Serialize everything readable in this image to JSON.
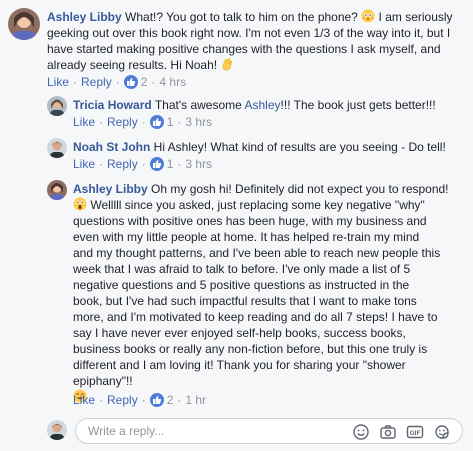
{
  "comments": [
    {
      "author": "Ashley Libby",
      "text_lines": [
        " What!? You got to talk to him on the phone? ",
        " I am seriously",
        "geeking out over this book right now. I'm not even 1/3 of the way into it, but I",
        "have started making positive changes with the questions I ask myself, and",
        "already seeing results. Hi Noah! "
      ],
      "like_label": "Like",
      "reply_label": "Reply",
      "reaction_count": "2",
      "time": "4 hrs"
    },
    {
      "author": "Tricia Howard",
      "text_before": " That's awesome ",
      "mention": "Ashley",
      "text_after": "!!! The book just gets better!!!",
      "like_label": "Like",
      "reply_label": "Reply",
      "reaction_count": "1",
      "time": "3 hrs"
    },
    {
      "author": "Noah St John",
      "text": " Hi Ashley! What kind of results are you seeing - Do tell!",
      "like_label": "Like",
      "reply_label": "Reply",
      "reaction_count": "1",
      "time": "3 hrs"
    },
    {
      "author": "Ashley Libby",
      "first_line": " Oh my gosh hi! Definitely did not expect you to respond!",
      "text_lines": [
        " Welllll since you asked, just replacing some key negative \"why\"",
        "questions with positive ones has been huge, with my business and",
        "even with my little people at home. It has helped re-train my mind",
        "and my thought patterns, and I've been able to reach new people this",
        "week that I was afraid to talk to before. I've only made a list of 5",
        "negative questions and 5 positive questions as instructed in the",
        "book, but I've had such impactful results that I want to make tons",
        "more, and I'm motivated to keep reading and do all 7 steps! I have to",
        "say I have never ever enjoyed self-help books, success books,",
        "business books or really any non-fiction before, but this one truly is",
        "different and I am loving it! Thank you for sharing your \"shower",
        "epiphany\"!! "
      ],
      "like_label": "Like",
      "reply_label": "Reply",
      "reaction_count": "2",
      "time": "1 hr"
    }
  ],
  "reply_box": {
    "placeholder": "Write a reply..."
  },
  "icons": {
    "emoji": "smiley-icon",
    "camera": "camera-icon",
    "gif": "gif-icon",
    "sticker": "sticker-icon"
  },
  "colors": {
    "name": "#365899",
    "link": "#4267b2",
    "meta": "#90949c",
    "like_badge": "#4f7dd6",
    "background": "#f6f7f9"
  }
}
